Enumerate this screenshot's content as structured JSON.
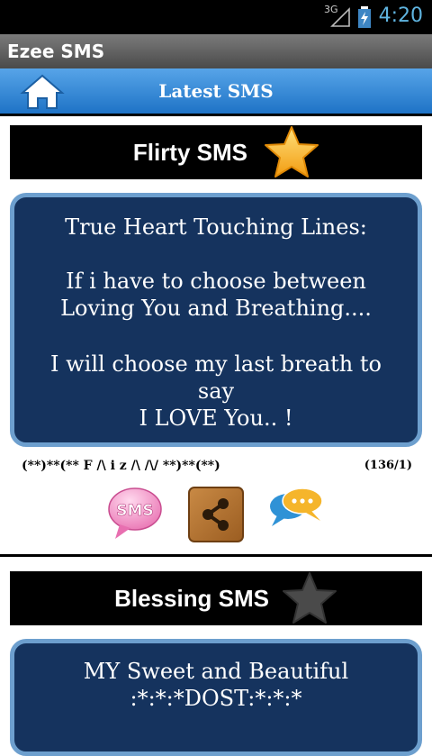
{
  "status": {
    "network": "3G",
    "time": "4:20"
  },
  "app": {
    "title": "Ezee SMS"
  },
  "nav": {
    "title": "Latest SMS",
    "home_icon": "home-icon"
  },
  "categories": [
    {
      "label": "Flirty SMS",
      "star": "gold-star",
      "message_lines": [
        "True Heart Touching Lines:",
        "",
        "If i have to choose between",
        "Loving You and Breathing....",
        "",
        "I will choose my last breath to",
        "say",
        "I LOVE You.. !"
      ],
      "author": "(**)**(** F /\\ i z /\\ /\\/ **)**(**)",
      "counter": "(136/1)",
      "actions": {
        "sms_label": "SMS"
      }
    },
    {
      "label": "Blessing SMS",
      "star": "gray-star",
      "message_lines": [
        "MY  Sweet and Beautiful",
        ":*:*:*DOST:*:*:*"
      ]
    }
  ],
  "colors": {
    "card_bg": "#15335e",
    "card_border": "#6d9fce",
    "nav_blue": "#1e73c6",
    "gold": "#f7b928"
  }
}
